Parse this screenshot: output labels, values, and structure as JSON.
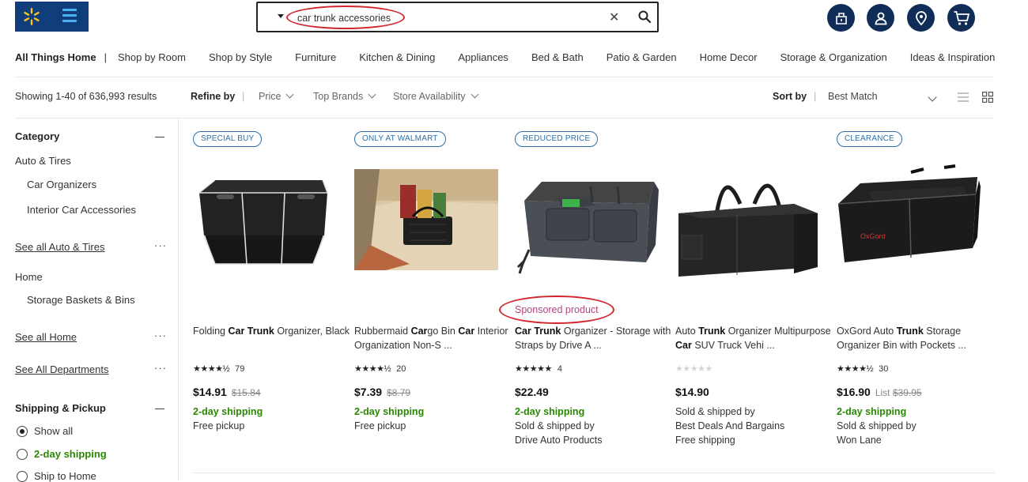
{
  "header": {
    "logo_label": "Walmart",
    "search": {
      "value": "car trunk accessories",
      "placeholder": ""
    },
    "icons": [
      "reorder-icon",
      "account-icon",
      "store-locator-icon",
      "cart-icon"
    ]
  },
  "dept_nav": {
    "current": "All Things Home",
    "separator": "|",
    "items": [
      "Shop by Room",
      "Shop by Style",
      "Furniture",
      "Kitchen & Dining",
      "Appliances",
      "Bed & Bath",
      "Patio & Garden",
      "Home Decor",
      "Storage & Organization",
      "Ideas & Inspiration"
    ]
  },
  "results": {
    "count_text": "Showing 1-40 of 636,993 results",
    "refine_label": "Refine by",
    "filters": [
      "Price",
      "Top Brands",
      "Store Availability"
    ],
    "sort_label": "Sort by",
    "sort_value": "Best Match"
  },
  "sidebar": {
    "category_title": "Category",
    "auto_title": "Auto & Tires",
    "auto_items": [
      "Car Organizers",
      "Interior Car Accessories"
    ],
    "see_all_auto": "See all Auto & Tires",
    "home_title": "Home",
    "home_items": [
      "Storage Baskets & Bins"
    ],
    "see_all_home": "See all Home",
    "see_all_departments": "See All Departments",
    "more_dots": "···",
    "shipping_title": "Shipping & Pickup",
    "shipping_options": [
      {
        "label": "Show all",
        "selected": true
      },
      {
        "label": "2-day shipping",
        "selected": false
      },
      {
        "label": "Ship to Home",
        "selected": false
      }
    ]
  },
  "products": [
    {
      "badge": "SPECIAL BUY",
      "title_parts": [
        "Folding ",
        "Car Trunk",
        " Organizer, Black"
      ],
      "rating": 4.5,
      "stars_text": "★★★★½",
      "review_count": "79",
      "price": "$14.91",
      "was_price": "$15.84",
      "was_label": "",
      "lines": [
        "2-day shipping",
        "Free pickup"
      ],
      "sponsored": ""
    },
    {
      "badge": "ONLY AT WALMART",
      "title_parts": [
        "Rubbermaid ",
        "Car",
        "go Bin ",
        "Car",
        " Interior Organization Non-S ..."
      ],
      "rating": 4.5,
      "stars_text": "★★★★½",
      "review_count": "20",
      "price": "$7.39",
      "was_price": "$8.79",
      "was_label": "",
      "lines": [
        "2-day shipping",
        "Free pickup"
      ],
      "sponsored": ""
    },
    {
      "badge": "REDUCED PRICE",
      "title_parts": [
        "",
        "Car Trunk",
        " Organizer - Storage with Straps by Drive A ..."
      ],
      "rating": 5,
      "stars_text": "★★★★★",
      "review_count": "4",
      "price": "$22.49",
      "was_price": "",
      "was_label": "",
      "lines": [
        "2-day shipping",
        "Sold & shipped by",
        "Drive Auto Products"
      ],
      "sponsored": "Sponsored product"
    },
    {
      "badge": "",
      "title_parts": [
        "Auto ",
        "Trunk",
        " Organizer Multipurpose ",
        "Car",
        " SUV Truck Vehi ..."
      ],
      "rating": 0,
      "stars_text": "★★★★★",
      "review_count": "",
      "price": "$14.90",
      "was_price": "",
      "was_label": "",
      "lines": [
        "Sold & shipped by",
        "Best Deals And Bargains",
        "Free shipping"
      ],
      "sponsored": ""
    },
    {
      "badge": "CLEARANCE",
      "title_parts": [
        "OxGord Auto ",
        "Trunk",
        " Storage Organizer Bin with Pockets ..."
      ],
      "rating": 4.5,
      "stars_text": "★★★★½",
      "review_count": "30",
      "price": "$16.90",
      "was_price": "$39.95",
      "was_label": "List",
      "lines": [
        "2-day shipping",
        "Sold & shipped by",
        "Won Lane"
      ],
      "sponsored": ""
    }
  ],
  "colors": {
    "brand_blue": "#0f3e7a",
    "spark_yellow": "#ffc220",
    "shipping_green": "#2a8703",
    "badge_blue": "#2a6fa8",
    "sponsored_pink": "#b5457d",
    "annotation_red": "#d0262d"
  }
}
